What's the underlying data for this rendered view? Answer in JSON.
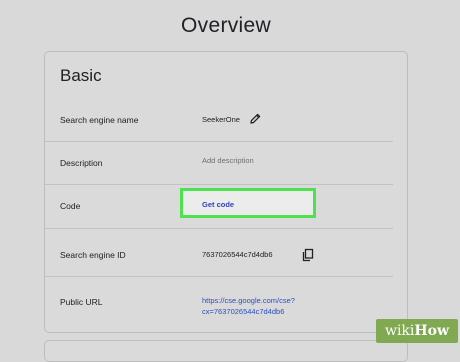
{
  "page": {
    "title": "Overview"
  },
  "basic": {
    "section_title": "Basic",
    "rows": [
      {
        "label": "Search engine name",
        "value": "SeekerOne"
      },
      {
        "label": "Description",
        "value": "Add description"
      },
      {
        "label": "Code",
        "value": "Get code"
      },
      {
        "label": "Search engine ID",
        "value": "7637026544c7d4db6"
      },
      {
        "label": "Public URL",
        "value_line1": "https://cse.google.com/cse?",
        "value_line2": "cx=7637026544c7d4db6"
      }
    ]
  },
  "icons": {
    "edit": "pencil-icon",
    "copy": "copy-icon"
  },
  "colors": {
    "highlight": "#4de24f",
    "link": "#2a4fc4",
    "background": "#d9d9d9"
  },
  "watermark": {
    "prefix": "wiki",
    "suffix": "How"
  }
}
